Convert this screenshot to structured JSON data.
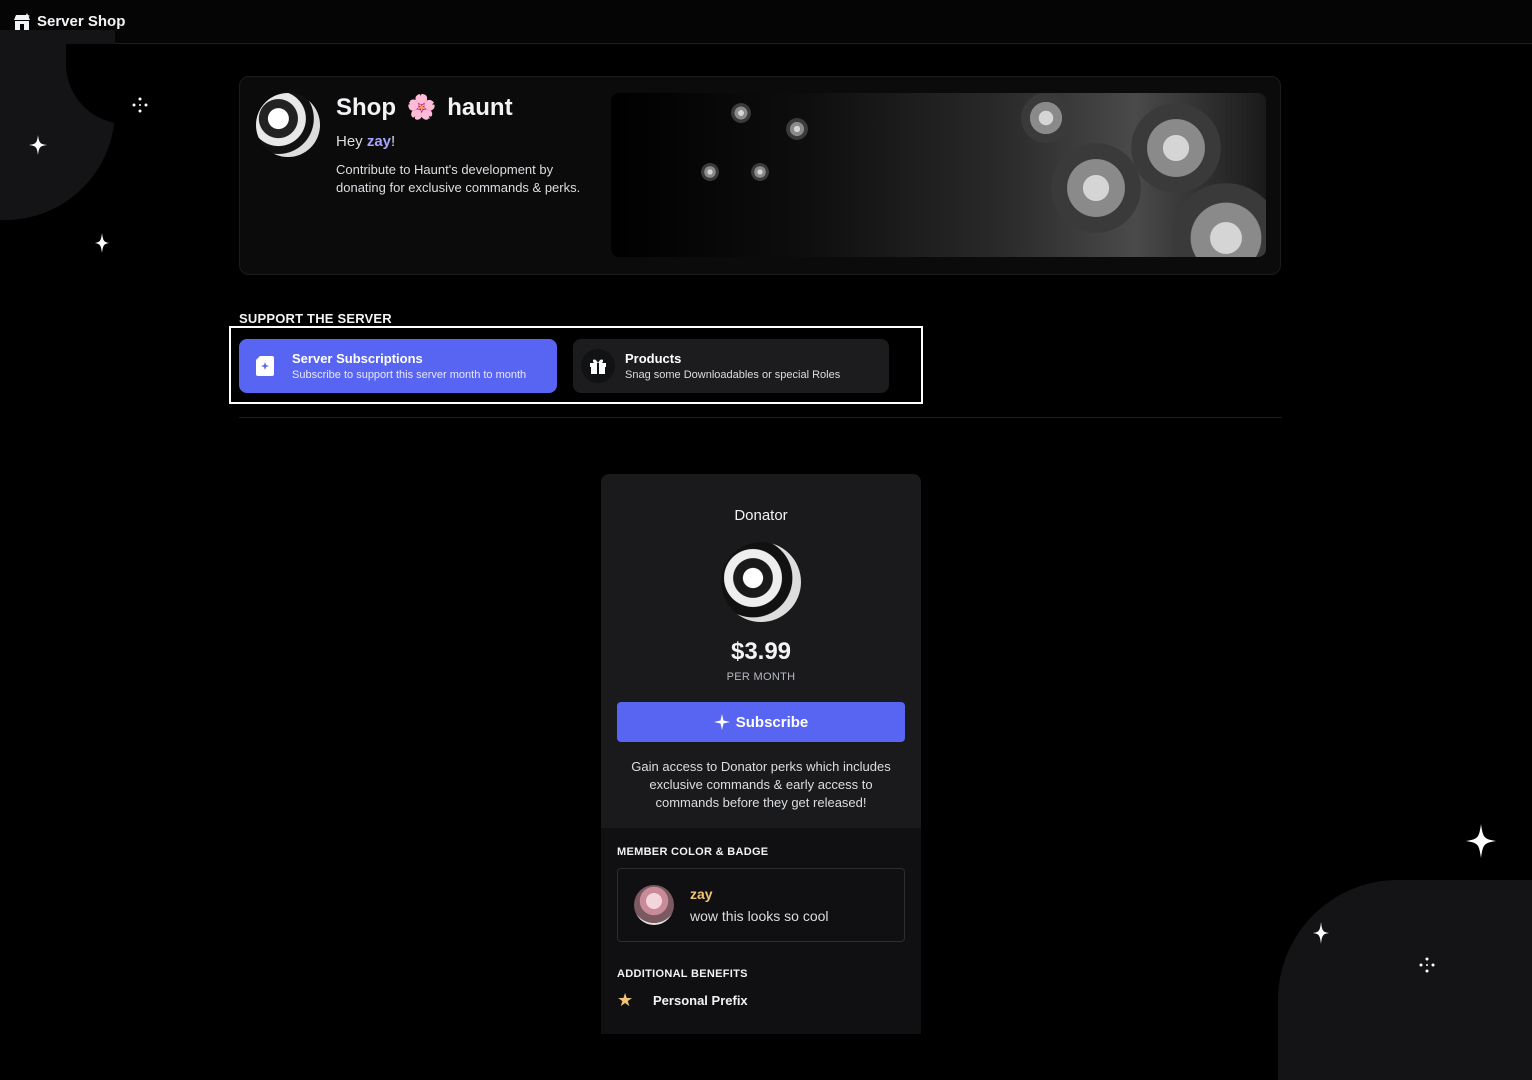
{
  "topbar": {
    "title": "Server Shop",
    "icon": "shop-icon"
  },
  "hero": {
    "title_prefix": "Shop",
    "title_emoji": "🌸",
    "server_name": "haunt",
    "greeting_prefix": "Hey ",
    "username": "zay",
    "greeting_suffix": "!",
    "description": "Contribute to Haunt's development by donating for exclusive commands & perks."
  },
  "support": {
    "section_label": "SUPPORT THE SERVER",
    "tabs": [
      {
        "name": "Server Subscriptions",
        "subtitle": "Subscribe to support this server month to month",
        "icon": "subscription-icon",
        "active": true
      },
      {
        "name": "Products",
        "subtitle": "Snag some Downloadables or special Roles",
        "icon": "gift-icon",
        "active": false
      }
    ]
  },
  "tier": {
    "name": "Donator",
    "price": "$3.99",
    "period": "PER MONTH",
    "subscribe_label": "Subscribe",
    "description": "Gain access to Donator perks which includes exclusive commands & early access to commands before they get released!",
    "member_color_label": "MEMBER COLOR & BADGE",
    "preview": {
      "username": "zay",
      "message": "wow this looks so cool",
      "name_color": "#f0c674"
    },
    "additional_label": "ADDITIONAL BENEFITS",
    "benefits": [
      {
        "icon": "star-icon",
        "label": "Personal Prefix"
      }
    ]
  },
  "colors": {
    "accent": "#5865f2",
    "background": "#000000",
    "card": "#1a1a1d"
  }
}
